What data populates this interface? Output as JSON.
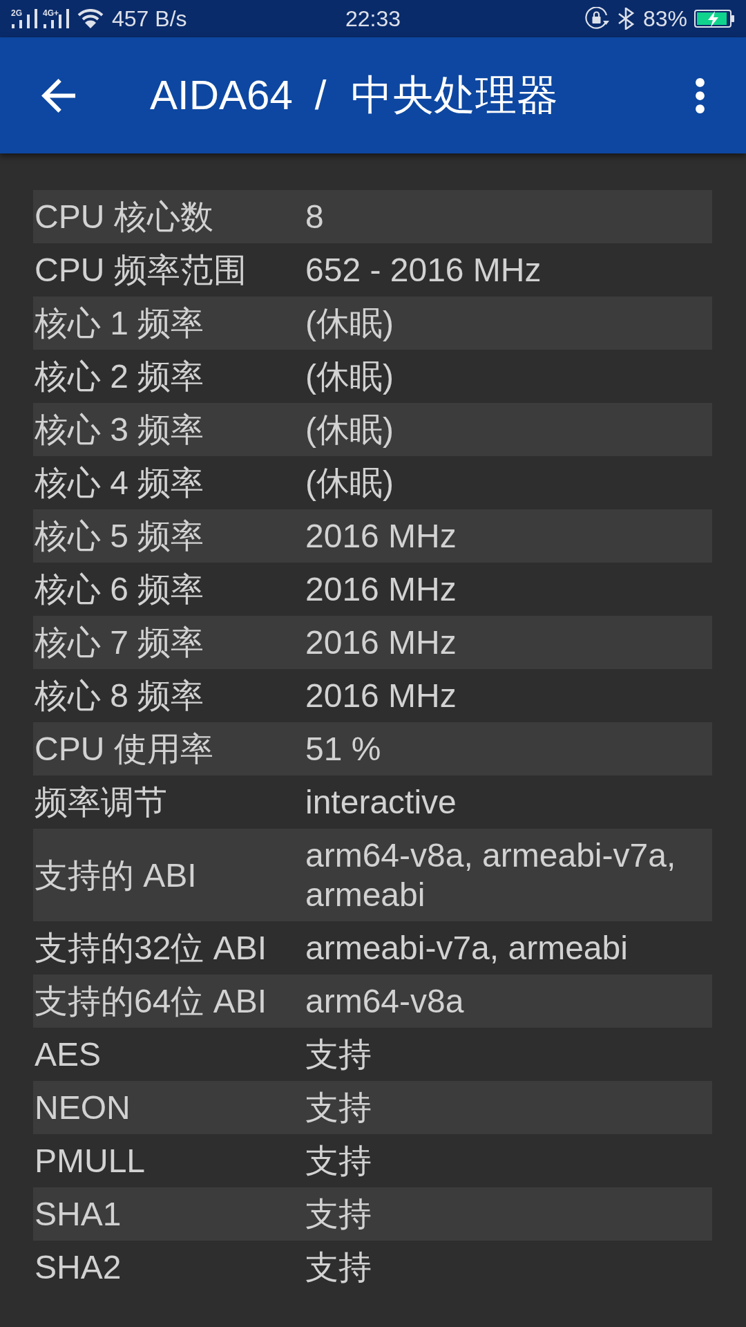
{
  "status_bar": {
    "signals": [
      {
        "label": "2G"
      },
      {
        "label": "4G+"
      }
    ],
    "net_speed": "457 B/s",
    "time": "22:33",
    "battery": "83%"
  },
  "app_bar": {
    "app_name": "AIDA64",
    "separator": "/",
    "page_title": "中央处理器"
  },
  "rows": [
    {
      "label": "CPU 核心数",
      "value": "8"
    },
    {
      "label": "CPU 频率范围",
      "value": "652 - 2016 MHz"
    },
    {
      "label": "核心 1 频率",
      "value": "(休眠)"
    },
    {
      "label": "核心 2 频率",
      "value": "(休眠)"
    },
    {
      "label": "核心 3 频率",
      "value": "(休眠)"
    },
    {
      "label": "核心 4 频率",
      "value": "(休眠)"
    },
    {
      "label": "核心 5 频率",
      "value": "2016 MHz"
    },
    {
      "label": "核心 6 频率",
      "value": "2016 MHz"
    },
    {
      "label": "核心 7 频率",
      "value": "2016 MHz"
    },
    {
      "label": "核心 8 频率",
      "value": "2016 MHz"
    },
    {
      "label": "CPU 使用率",
      "value": "51 %"
    },
    {
      "label": "频率调节",
      "value": "interactive"
    },
    {
      "label": "支持的 ABI",
      "value": "arm64-v8a, armeabi-v7a, armeabi"
    },
    {
      "label": "支持的32位 ABI",
      "value": "armeabi-v7a, armeabi"
    },
    {
      "label": "支持的64位 ABI",
      "value": "arm64-v8a"
    },
    {
      "label": "AES",
      "value": "支持"
    },
    {
      "label": "NEON",
      "value": "支持"
    },
    {
      "label": "PMULL",
      "value": "支持"
    },
    {
      "label": "SHA1",
      "value": "支持"
    },
    {
      "label": "SHA2",
      "value": "支持"
    }
  ]
}
